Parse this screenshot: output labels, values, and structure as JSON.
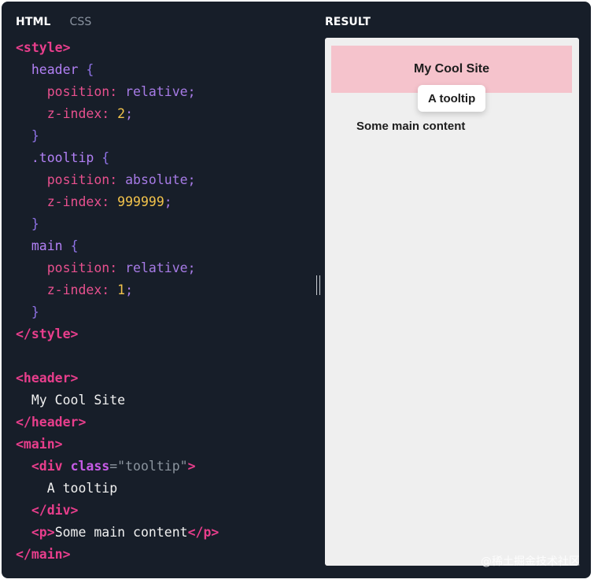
{
  "tabs": [
    {
      "label": "HTML",
      "active": true
    },
    {
      "label": "CSS",
      "active": false
    }
  ],
  "result_label": "RESULT",
  "code": {
    "style_open": "<style>",
    "header_sel": "header",
    "tooltip_sel": ".tooltip",
    "main_sel": "main",
    "open_brace": "{",
    "close_brace": "}",
    "prop_position": "position:",
    "prop_zindex": "z-index:",
    "val_relative": "relative",
    "val_absolute": "absolute",
    "semicolon": ";",
    "header_z": "2",
    "tooltip_z": "999999",
    "main_z": "1",
    "style_close": "</style>",
    "header_open": "<header>",
    "header_text": "My Cool Site",
    "header_close": "</header>",
    "main_open": "<main>",
    "div_open_start": "<div",
    "class_attr": "class",
    "equals": "=",
    "class_value": "\"tooltip\"",
    "tag_end": ">",
    "tooltip_text": "A tooltip",
    "div_close": "</div>",
    "p_open": "<p>",
    "p_text": "Some main content",
    "p_close": "</p>",
    "main_close": "</main>"
  },
  "result": {
    "header_text": "My Cool Site",
    "tooltip_text": "A tooltip",
    "main_text": "Some main content"
  },
  "watermark": "@稀土掘金技术社区",
  "colors": {
    "editor_bg": "#171e29",
    "tag": "#e83e8c",
    "selector": "#b280f5",
    "number": "#f3c34b",
    "result_bg": "#efefef",
    "header_bg": "#f5c3cc"
  }
}
